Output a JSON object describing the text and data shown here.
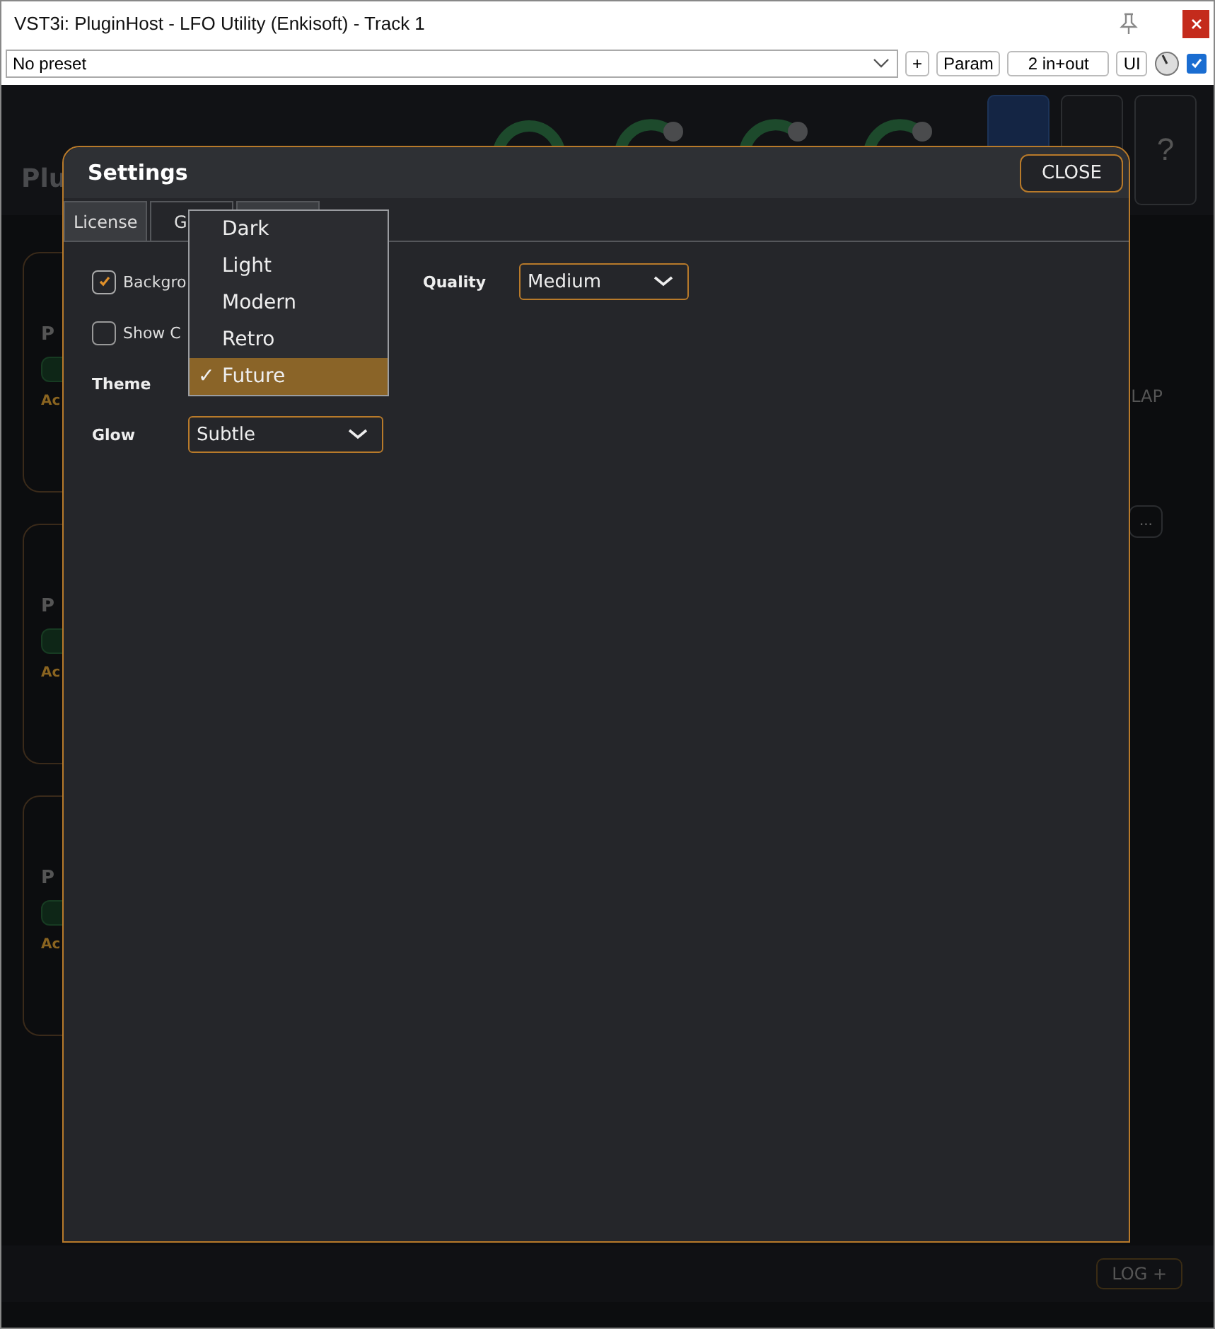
{
  "window": {
    "title": "VST3i: PluginHost - LFO Utility (Enkisoft) - Track 1"
  },
  "toolbar": {
    "preset": "No preset",
    "buttons": [
      "+",
      "Param",
      "2 in+out",
      "UI"
    ],
    "enabled": true
  },
  "plugin": {
    "title": "Plu",
    "knobs": [
      {
        "kind": "ring"
      },
      {
        "kind": "arc"
      },
      {
        "kind": "arc"
      },
      {
        "kind": "arc"
      }
    ],
    "header_buttons": [
      {
        "selected": true
      },
      {
        "selected": false
      },
      {
        "selected": false,
        "label": "?"
      }
    ],
    "left_cards": [
      {
        "title": "P",
        "label": "Ac"
      },
      {
        "title": "P",
        "label": "Ac"
      },
      {
        "title": "P",
        "label": "Ac"
      }
    ],
    "right_label": "LAP",
    "right_more": "...",
    "log_button": "LOG +"
  },
  "settings": {
    "title": "Settings",
    "close": "CLOSE",
    "tabs": [
      {
        "label": "License",
        "selected": false
      },
      {
        "label": "G",
        "selected": true
      },
      {
        "selected": false
      }
    ],
    "options": [
      {
        "label": "Backgro",
        "checked": true
      },
      {
        "label": "Show C",
        "checked": false
      }
    ],
    "theme": {
      "label": "Theme",
      "mark": "✓",
      "options": [
        {
          "label": "Dark",
          "selected": false
        },
        {
          "label": "Light",
          "selected": false
        },
        {
          "label": "Modern",
          "selected": false
        },
        {
          "label": "Retro",
          "selected": false
        },
        {
          "label": "Future",
          "selected": true
        }
      ]
    },
    "glow": {
      "label": "Glow",
      "value": "Subtle"
    },
    "quality": {
      "label": "Quality",
      "value": "Medium"
    }
  }
}
